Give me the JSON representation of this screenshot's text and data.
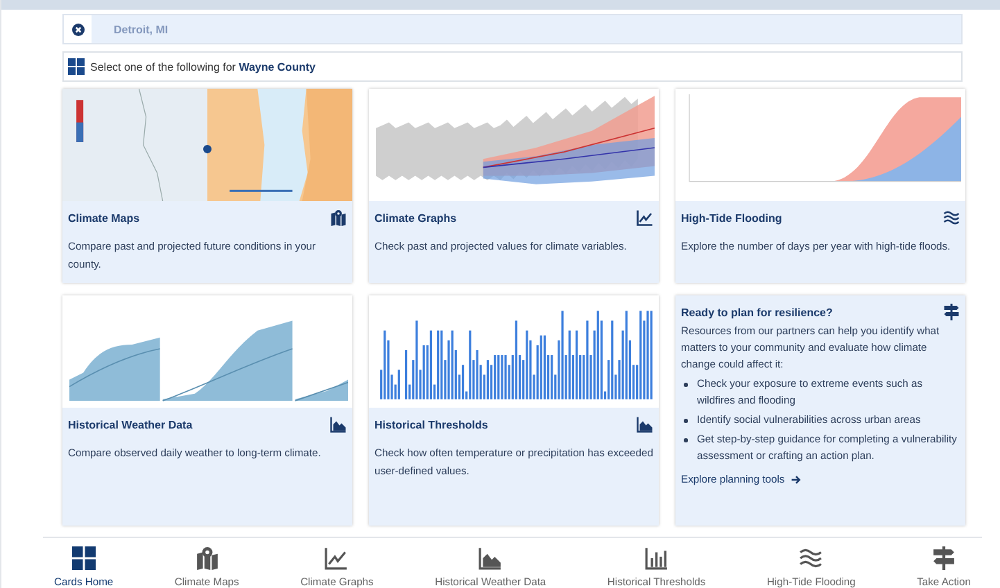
{
  "location": {
    "value": "Detroit, MI"
  },
  "prompt": "Select one of the following for **Wayne County**",
  "cards": [
    {
      "kind": "map",
      "title": "Climate Maps",
      "text": "Compare past and projected future conditions in your county."
    },
    {
      "kind": "bands",
      "title": "Climate Graphs",
      "text": "Check past and projected values for climate variables."
    },
    {
      "kind": "flood",
      "title": "High-Tide Flooding",
      "text": "Explore the number of days per year with high-tide floods."
    },
    {
      "kind": "weather",
      "title": "Historical Weather Data",
      "text": "Compare observed daily weather to long-term climate."
    },
    {
      "kind": "bars",
      "title": "Historical Thresholds",
      "text": "Check how often temperature or precipitation has exceeded user-defined values."
    }
  ],
  "plan": {
    "title": "Ready to plan for resilience?",
    "intro": "Resources from our partners can help you identify what matters to your community and evaluate how climate change could affect it:",
    "bullets": [
      "Check your exposure to extreme events such as wildfires and flooding",
      "Identify social vulnerabilities across urban areas",
      "Get step-by-step guidance for completing a vulnerability assessment or crafting an action plan."
    ],
    "link": "Explore planning tools"
  },
  "nav": [
    {
      "label": "Cards Home",
      "selected": true
    },
    {
      "label": "Climate Maps",
      "selected": false
    },
    {
      "label": "Climate Graphs",
      "selected": false
    },
    {
      "label": "Historical Weather Data",
      "selected": false
    },
    {
      "label": "Historical Thresholds",
      "selected": false
    },
    {
      "label": "High-Tide Flooding",
      "selected": false
    },
    {
      "label": "Take Action",
      "selected": false
    }
  ]
}
